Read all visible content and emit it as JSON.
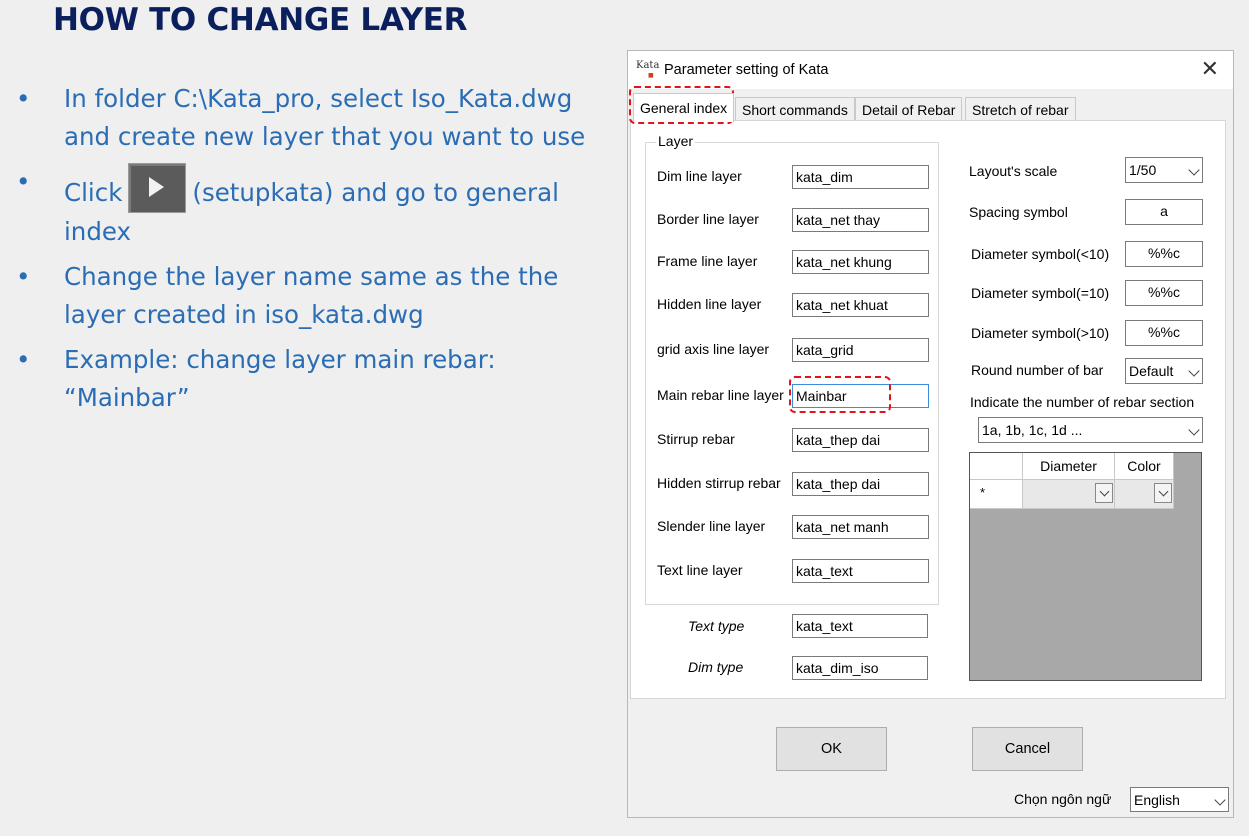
{
  "slide": {
    "title": "HOW TO CHANGE LAYER",
    "bullets": [
      "In folder C:\\Kata_pro, select Iso_Kata.dwg and create new layer that you want to use",
      "Click",
      "(setupkata) and go to general index",
      "Change the layer name same as the the layer created in iso_kata.dwg",
      "Example: change layer main rebar: “Mainbar”"
    ],
    "bullet_symbol": "•",
    "setup_icon": "play-icon"
  },
  "dialog": {
    "title": "Parameter setting of Kata",
    "icon_text": "Kata",
    "close": "✕",
    "tabs": [
      "General index",
      "Short commands",
      "Detail of Rebar",
      "Stretch of rebar"
    ],
    "layer_group": "Layer",
    "layers": [
      {
        "label": "Dim line layer",
        "value": "kata_dim"
      },
      {
        "label": "Border line layer",
        "value": "kata_net thay"
      },
      {
        "label": "Frame line layer",
        "value": "kata_net khung"
      },
      {
        "label": "Hidden line layer",
        "value": "kata_net khuat"
      },
      {
        "label": "grid axis line layer",
        "value": "kata_grid"
      },
      {
        "label": "Main rebar line layer",
        "value": "Mainbar"
      },
      {
        "label": "Stirrup rebar",
        "value": "kata_thep dai"
      },
      {
        "label": "Hidden stirrup rebar",
        "value": "kata_thep dai"
      },
      {
        "label": "Slender line layer",
        "value": "kata_net manh"
      },
      {
        "label": "Text line layer",
        "value": "kata_text"
      }
    ],
    "text_type": {
      "label": "Text type",
      "value": "kata_text"
    },
    "dim_type": {
      "label": "Dim type",
      "value": "kata_dim_iso"
    },
    "right": {
      "layout_scale": {
        "label": "Layout's scale",
        "value": "1/50"
      },
      "spacing_symbol": {
        "label": "Spacing symbol",
        "value": "a"
      },
      "diam_lt10": {
        "label": "Diameter symbol(<10)",
        "value": "%%c"
      },
      "diam_eq10": {
        "label": "Diameter symbol(=10)",
        "value": "%%c"
      },
      "diam_gt10": {
        "label": "Diameter symbol(>10)",
        "value": "%%c"
      },
      "round_bar": {
        "label": "Round number of bar",
        "value": "Default"
      },
      "rebar_section": {
        "label": "Indicate the number of rebar section",
        "value": "1a, 1b, 1c, 1d ..."
      }
    },
    "grid": {
      "columns": [
        "Diameter",
        "Color"
      ],
      "new_row_marker": "*"
    },
    "buttons": {
      "ok": "OK",
      "cancel": "Cancel"
    },
    "language": {
      "label": "Chọn ngôn ngữ",
      "value": "English"
    }
  },
  "colors": {
    "title": "#0a1f5c",
    "bullet_text": "#2a6db5",
    "highlight": "#e0141b",
    "focus_border": "#3c8ddc"
  }
}
